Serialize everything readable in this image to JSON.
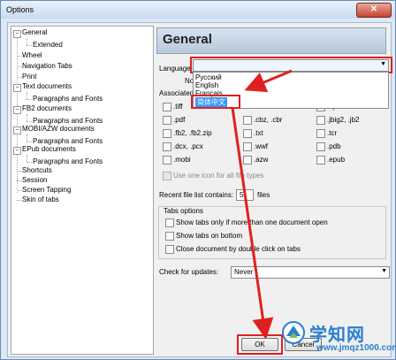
{
  "window": {
    "title": "Options",
    "close_label": "✕"
  },
  "tree": {
    "items": [
      {
        "label": "General",
        "level": 0
      },
      {
        "label": "Extended",
        "level": 1
      },
      {
        "label": "Wheel",
        "level": 0
      },
      {
        "label": "Navigation Tabs",
        "level": 0
      },
      {
        "label": "Print",
        "level": 0
      },
      {
        "label": "Text documents",
        "level": 0
      },
      {
        "label": "Paragraphs and Fonts",
        "level": 1
      },
      {
        "label": "FB2 documents",
        "level": 0
      },
      {
        "label": "Paragraphs and Fonts",
        "level": 1
      },
      {
        "label": "MOBI/AZW documents",
        "level": 0
      },
      {
        "label": "Paragraphs and Fonts",
        "level": 1
      },
      {
        "label": "EPub documents",
        "level": 0
      },
      {
        "label": "Paragraphs and Fonts",
        "level": 1
      },
      {
        "label": "Shortcuts",
        "level": 0
      },
      {
        "label": "Session",
        "level": 0
      },
      {
        "label": "Screen Tapping",
        "level": 0
      },
      {
        "label": "Skin of tabs",
        "level": 0
      }
    ]
  },
  "panel": {
    "title": "General",
    "language_label": "Language:",
    "language_value": "",
    "language_options": [
      "Русский",
      "English",
      "Français",
      "简体中文"
    ],
    "partial_no": "No",
    "associated_label": "Associated",
    "file_types": [
      [
        ".tiff",
        "",
        ".xps"
      ],
      [
        ".pdf",
        ".cbz, .cbr",
        ".jbig2, .jb2"
      ],
      [
        ".fb2, .fb2.zip",
        ".txt",
        ".tcr"
      ],
      [
        ".dcx, .pcx",
        ".wwf",
        ".pdb"
      ],
      [
        ".mobi",
        ".azw",
        ".epub"
      ]
    ],
    "one_icon_label": "Use one icon for all file types",
    "recent_label": "Recent file list contains:",
    "recent_value": "5",
    "recent_unit": "files",
    "tabs_group_label": "Tabs options",
    "tabs_options": [
      "Show tabs only if more than one document open",
      "Show tabs on bottom",
      "Close document by double click on tabs"
    ],
    "updates_label": "Check for updates:",
    "updates_value": "Never",
    "ok_label": "OK",
    "cancel_label": "Cancel"
  },
  "watermark": {
    "name": "学知网",
    "url": "www.jmqz1000.com"
  },
  "colors": {
    "highlight": "#3399ff",
    "annotation_red": "#e02020",
    "watermark_blue": "#2a7fd0"
  }
}
